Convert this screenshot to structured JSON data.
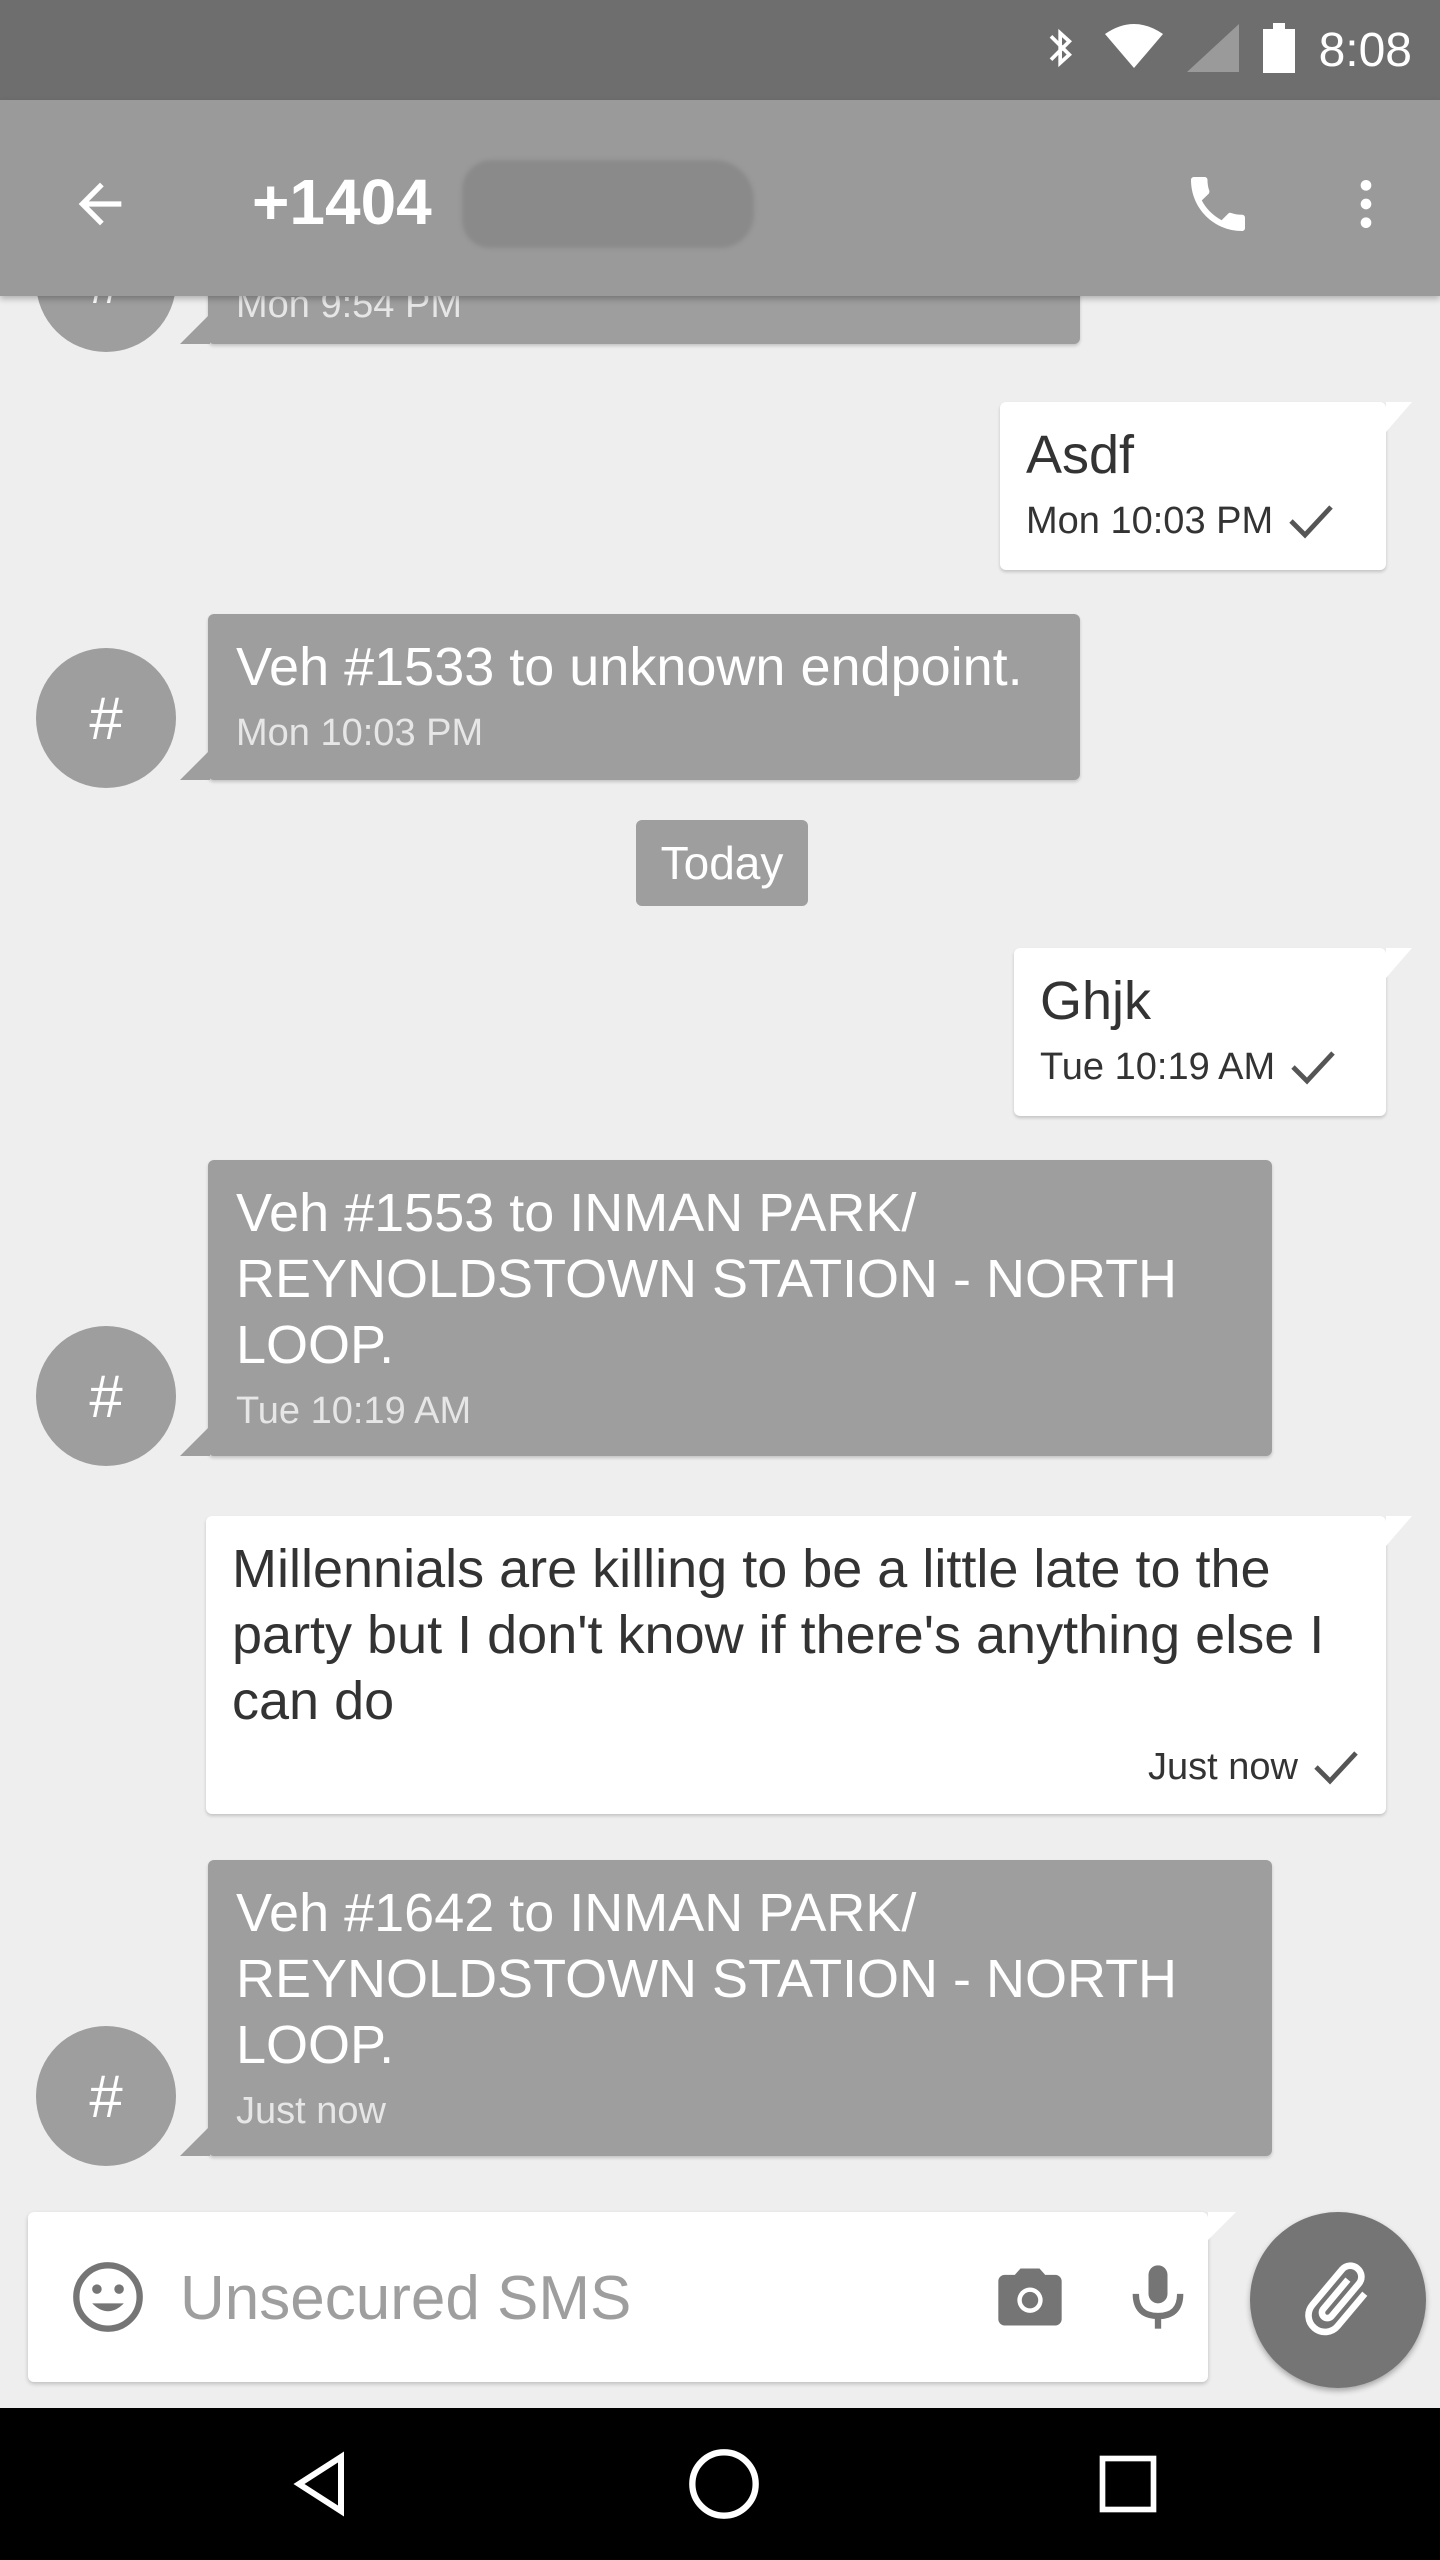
{
  "status_bar": {
    "time": "8:08"
  },
  "app_bar": {
    "title": "+1404"
  },
  "messages": [
    {
      "direction": "in",
      "text": "",
      "timestamp": "Mon 9:54 PM",
      "avatar": "#"
    },
    {
      "direction": "out",
      "text": "Asdf",
      "timestamp": "Mon 10:03 PM",
      "delivered": true
    },
    {
      "direction": "in",
      "text": "Veh #1533 to unknown endpoint.",
      "timestamp": "Mon 10:03 PM",
      "avatar": "#"
    },
    {
      "direction": "out",
      "text": "Ghjk",
      "timestamp": "Tue 10:19 AM",
      "delivered": true
    },
    {
      "direction": "in",
      "text": "Veh #1553 to INMAN PARK/ REYNOLDSTOWN STATION - NORTH LOOP.",
      "timestamp": "Tue 10:19 AM",
      "avatar": "#"
    },
    {
      "direction": "out",
      "text": "Millennials are killing to be a little late to the party but I don't know if there's anything else I can do",
      "timestamp": "Just now",
      "delivered": true
    },
    {
      "direction": "in",
      "text": "Veh #1642 to INMAN PARK/ REYNOLDSTOWN STATION - NORTH LOOP.",
      "timestamp": "Just now",
      "avatar": "#"
    }
  ],
  "date_divider": "Today",
  "composer": {
    "placeholder": "Unsecured SMS"
  },
  "icons": {
    "back": "arrow-back-icon",
    "call": "phone-icon",
    "menu": "more-vert-icon",
    "emoji": "emoji-icon",
    "camera": "camera-icon",
    "mic": "mic-icon",
    "attach": "paperclip-icon",
    "nav_back": "nav-back-icon",
    "nav_home": "nav-home-icon",
    "nav_recents": "nav-recents-icon"
  },
  "colors": {
    "status_bar": "#6e6e6e",
    "app_bar": "#9a9a9a",
    "incoming_bubble": "#9e9e9e",
    "outgoing_bubble": "#ffffff",
    "background": "#eeeeee",
    "fab": "#757575"
  }
}
